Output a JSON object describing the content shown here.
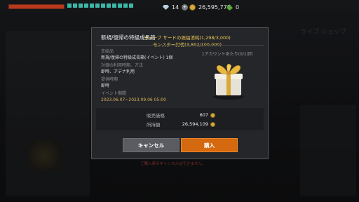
{
  "topbar": {
    "gems": "14",
    "gold": "26,595,770",
    "leaf": "0"
  },
  "background": {
    "shop_title": "ライブ ショップ"
  },
  "dialog": {
    "title": "新規/復帰の特級成長箱",
    "mission_line1": "ディープ サードの祝福消耗(1,298/3,000)",
    "mission_line2": "モンスター討伐(3,892/100,000)",
    "purchase_limit": "1アカウントあたり(0/1)回",
    "item_label": "支給品",
    "item_value": "新規/復帰の特級成長箱(イベント) 1個",
    "usage_label": "対価の利用時期、方法",
    "usage_value": "即時、アデナ利用",
    "timing_label": "提供時期",
    "timing_value": "即時",
    "period_label": "イベント期間",
    "period_value": "2023.06.07~2023.09.06 05:00",
    "price_label": "販売価格",
    "price_value": "607",
    "owned_label": "所持額",
    "owned_value": "26,594,109",
    "cancel_label": "キャンセル",
    "buy_label": "購入"
  },
  "warning": "ご購入時のキャンセルはできません。"
}
